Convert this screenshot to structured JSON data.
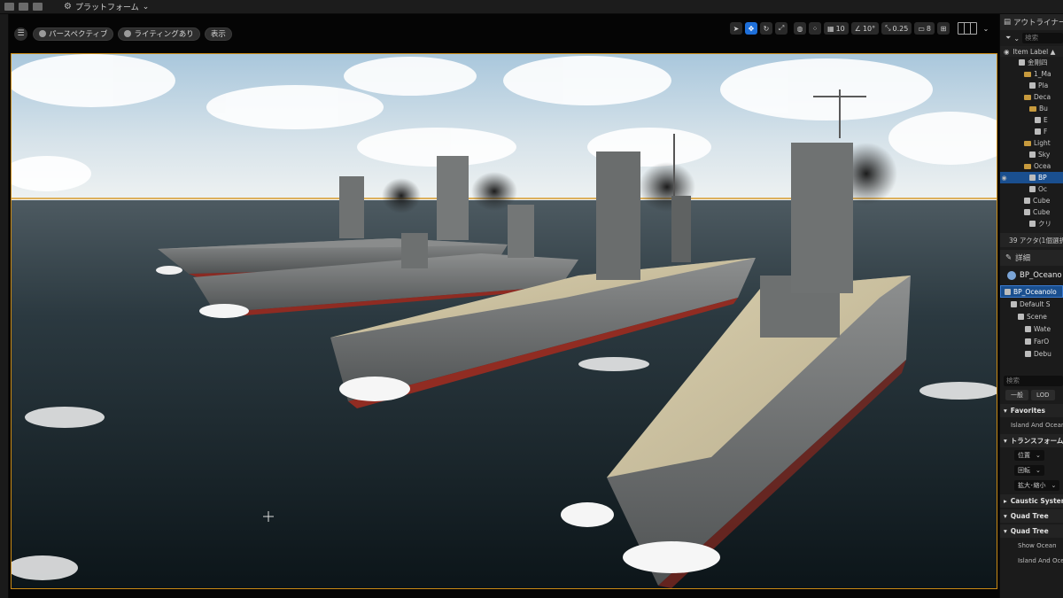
{
  "topbar": {
    "platform_label": "プラットフォーム",
    "platform_chevron": "⌄"
  },
  "viewport": {
    "menu_glyph": "☰",
    "perspective_label": "パースペクティブ",
    "lighting_label": "ライティングあり",
    "show_label": "表示",
    "tools": {
      "grid_snap_value": "10",
      "angle_snap_value": "10°",
      "scale_snap_value": "0.25",
      "camera_speed_value": "8"
    }
  },
  "outliner": {
    "title": "アウトライナー",
    "search_placeholder": "検索",
    "column_label": "Item Label ▲",
    "items": [
      {
        "label": "金剛四",
        "indent": 2,
        "kind": "actor",
        "selected": false
      },
      {
        "label": "1_Ma",
        "indent": 3,
        "kind": "folder",
        "selected": false
      },
      {
        "label": "Pla",
        "indent": 4,
        "kind": "actor",
        "selected": false
      },
      {
        "label": "Deca",
        "indent": 3,
        "kind": "folder",
        "selected": false
      },
      {
        "label": "Bu",
        "indent": 4,
        "kind": "folder",
        "selected": false
      },
      {
        "label": "E",
        "indent": 5,
        "kind": "actor",
        "selected": false
      },
      {
        "label": "F",
        "indent": 5,
        "kind": "actor",
        "selected": false
      },
      {
        "label": "Light",
        "indent": 3,
        "kind": "folder",
        "selected": false
      },
      {
        "label": "Sky",
        "indent": 4,
        "kind": "actor",
        "selected": false
      },
      {
        "label": "Ocea",
        "indent": 3,
        "kind": "folder",
        "selected": false
      },
      {
        "label": "BP",
        "indent": 4,
        "kind": "actor",
        "selected": true
      },
      {
        "label": "Oc",
        "indent": 4,
        "kind": "actor",
        "selected": false
      },
      {
        "label": "Cube",
        "indent": 3,
        "kind": "actor",
        "selected": false
      },
      {
        "label": "Cube",
        "indent": 3,
        "kind": "actor",
        "selected": false
      },
      {
        "label": "クリ",
        "indent": 4,
        "kind": "actor",
        "selected": false
      }
    ],
    "actor_count": "39 アクタ(1個選択"
  },
  "details": {
    "title": "詳細",
    "actor_name": "BP_Oceano",
    "components": [
      {
        "label": "BP_Oceanolo",
        "indent": 0,
        "selected": true
      },
      {
        "label": "Default S",
        "indent": 1,
        "selected": false
      },
      {
        "label": "Scene",
        "indent": 2,
        "selected": false
      },
      {
        "label": "Wate",
        "indent": 3,
        "selected": false
      },
      {
        "label": "FarO",
        "indent": 3,
        "selected": false
      },
      {
        "label": "Debu",
        "indent": 3,
        "selected": false
      }
    ],
    "search_placeholder": "検索",
    "tab_general": "一般",
    "tab_lod": "LOD",
    "sections": {
      "favorites": "Favorites",
      "favorites_item": "Island And Ocean",
      "transform": "トランスフォーム",
      "location": "位置",
      "rotation": "回転",
      "scale": "拡大･縮小",
      "caustic": "Caustic System",
      "quadtree_a": "Quad Tree",
      "quadtree_b": "Quad Tree",
      "show_ocean": "Show Ocean",
      "island_ocean": "Island And Ocean"
    }
  },
  "colors": {
    "selection_outline": "#c98a15",
    "accent_blue": "#1e6fd9",
    "folder": "#c79a3d"
  },
  "icons": [
    "menu-icon",
    "sphere-icon",
    "select-arrow-icon",
    "move-icon",
    "rotate-icon",
    "scale-icon",
    "globe-icon",
    "surface-snap-icon",
    "grid-icon",
    "angle-icon",
    "scale-snap-icon",
    "camera-icon",
    "layout-icon",
    "eye-icon",
    "filter-icon",
    "pin-icon",
    "chevron-down-icon",
    "crosshair-icon"
  ]
}
